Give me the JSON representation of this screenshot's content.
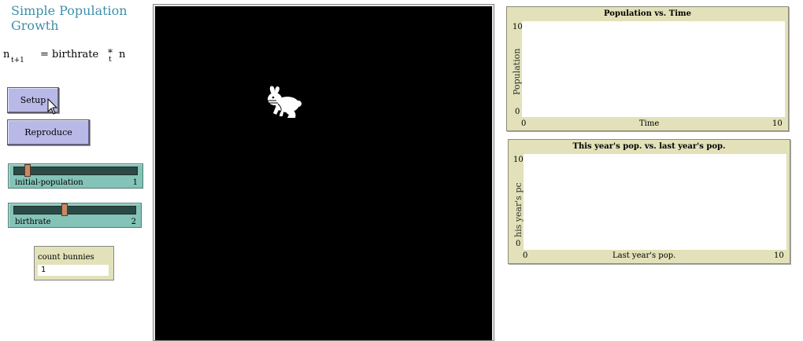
{
  "title": "Simple Population Growth",
  "formula": {
    "n": "n",
    "sub": "t+1",
    "rhs": "= birthrate",
    "star": "*",
    "t": "t",
    "n2": "n"
  },
  "buttons": {
    "setup": "Setup",
    "reproduce": "Reproduce"
  },
  "sliders": [
    {
      "label": "initial-population",
      "value": "1",
      "fraction": 0.09
    },
    {
      "label": "birthrate",
      "value": "2",
      "fraction": 0.41
    }
  ],
  "monitor": {
    "label": "count bunnies",
    "value": "1"
  },
  "plots": [
    {
      "title": "Population vs. Time",
      "ylabel": "Population",
      "xlabel": "Time",
      "x_min": "0",
      "x_max": "10",
      "y_min": "0",
      "y_max": "10"
    },
    {
      "title": "This year's pop. vs. last year's pop.",
      "ylabel": "his year's pc",
      "xlabel": "Last year's pop.",
      "x_min": "0",
      "x_max": "10",
      "y_min": "0",
      "y_max": "10"
    }
  ],
  "colors": {
    "button": "#b9b9e8",
    "slider": "#84c3b7",
    "monitor": "#e2e1b9",
    "world": "#000000",
    "title": "#3f8fa8"
  },
  "icons": {
    "turtle": "rabbit-icon",
    "pointer": "mouse-cursor-icon"
  }
}
